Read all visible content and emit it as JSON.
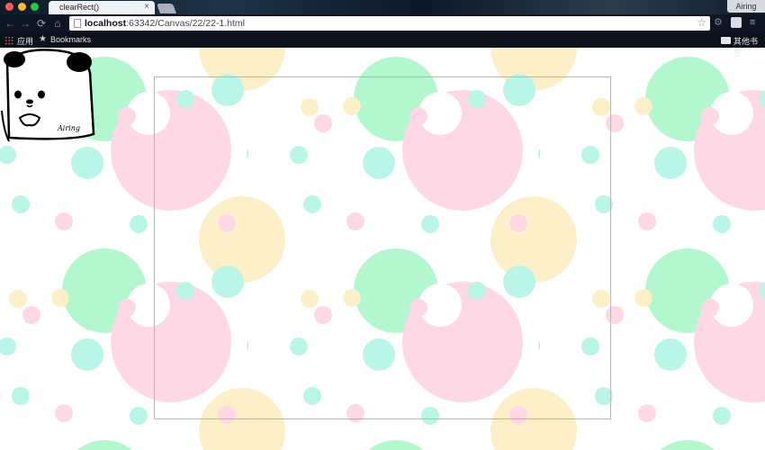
{
  "window": {
    "tab_title": "clearRect()",
    "tab_close": "×",
    "profile_name": "Airing"
  },
  "toolbar": {
    "url_host": "localhost",
    "url_rest": ":63342/Canvas/22/22-1.html",
    "back_icon": "←",
    "forward_icon": "→",
    "reload_icon": "⟳",
    "home_icon": "⌂",
    "bookmark_star": "☆",
    "menu_icon": "≡",
    "extension_icon": "⚙"
  },
  "bookmarks": {
    "apps_label": "应用",
    "bookmarks_label": "Bookmarks",
    "other_label": "其他书签",
    "star_glyph": "★"
  },
  "colors": {
    "pink": "#ffd8e6",
    "green": "#b3f7ce",
    "yellow": "#fdf0c8",
    "cyan": "#b9f6e8"
  },
  "mascot": {
    "signature": "Airing"
  }
}
